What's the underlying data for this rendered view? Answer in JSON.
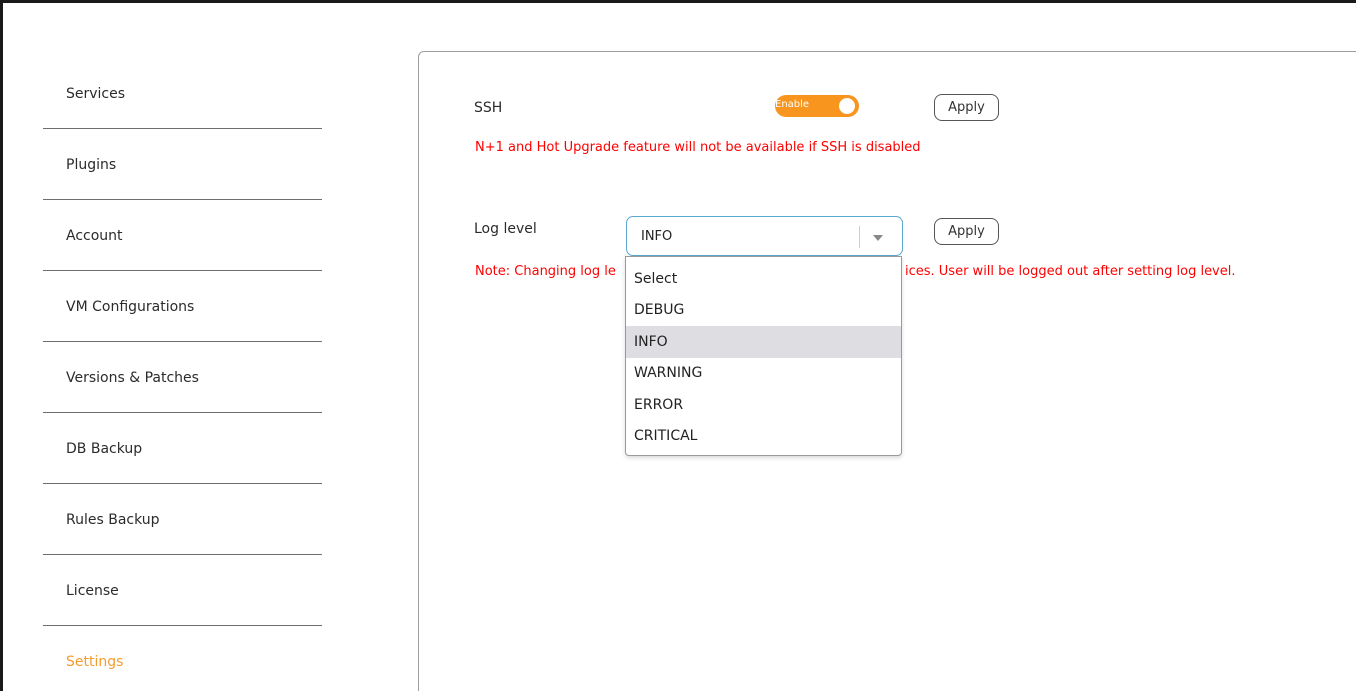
{
  "sidebar": {
    "items": [
      {
        "label": "Services"
      },
      {
        "label": "Plugins"
      },
      {
        "label": "Account"
      },
      {
        "label": "VM Configurations"
      },
      {
        "label": "Versions & Patches"
      },
      {
        "label": "DB Backup"
      },
      {
        "label": "Rules Backup"
      },
      {
        "label": "License"
      },
      {
        "label": "Settings"
      }
    ],
    "active": "Settings"
  },
  "ssh": {
    "label": "SSH",
    "toggle_text": "Enable",
    "toggle_state": "on",
    "apply_label": "Apply",
    "warning": "N+1 and Hot Upgrade feature will not be available if SSH is disabled"
  },
  "log": {
    "label": "Log level",
    "selected": "INFO",
    "apply_label": "Apply",
    "note_left": "Note: Changing log le",
    "note_right": "ices. User will be logged out after setting log level.",
    "options": [
      "Select",
      "DEBUG",
      "INFO",
      "WARNING",
      "ERROR",
      "CRITICAL"
    ]
  },
  "colors": {
    "accent": "#f7951e",
    "active_nav": "#f39c2e",
    "warning": "#ff0000",
    "focus_border": "#5aa9cf"
  }
}
